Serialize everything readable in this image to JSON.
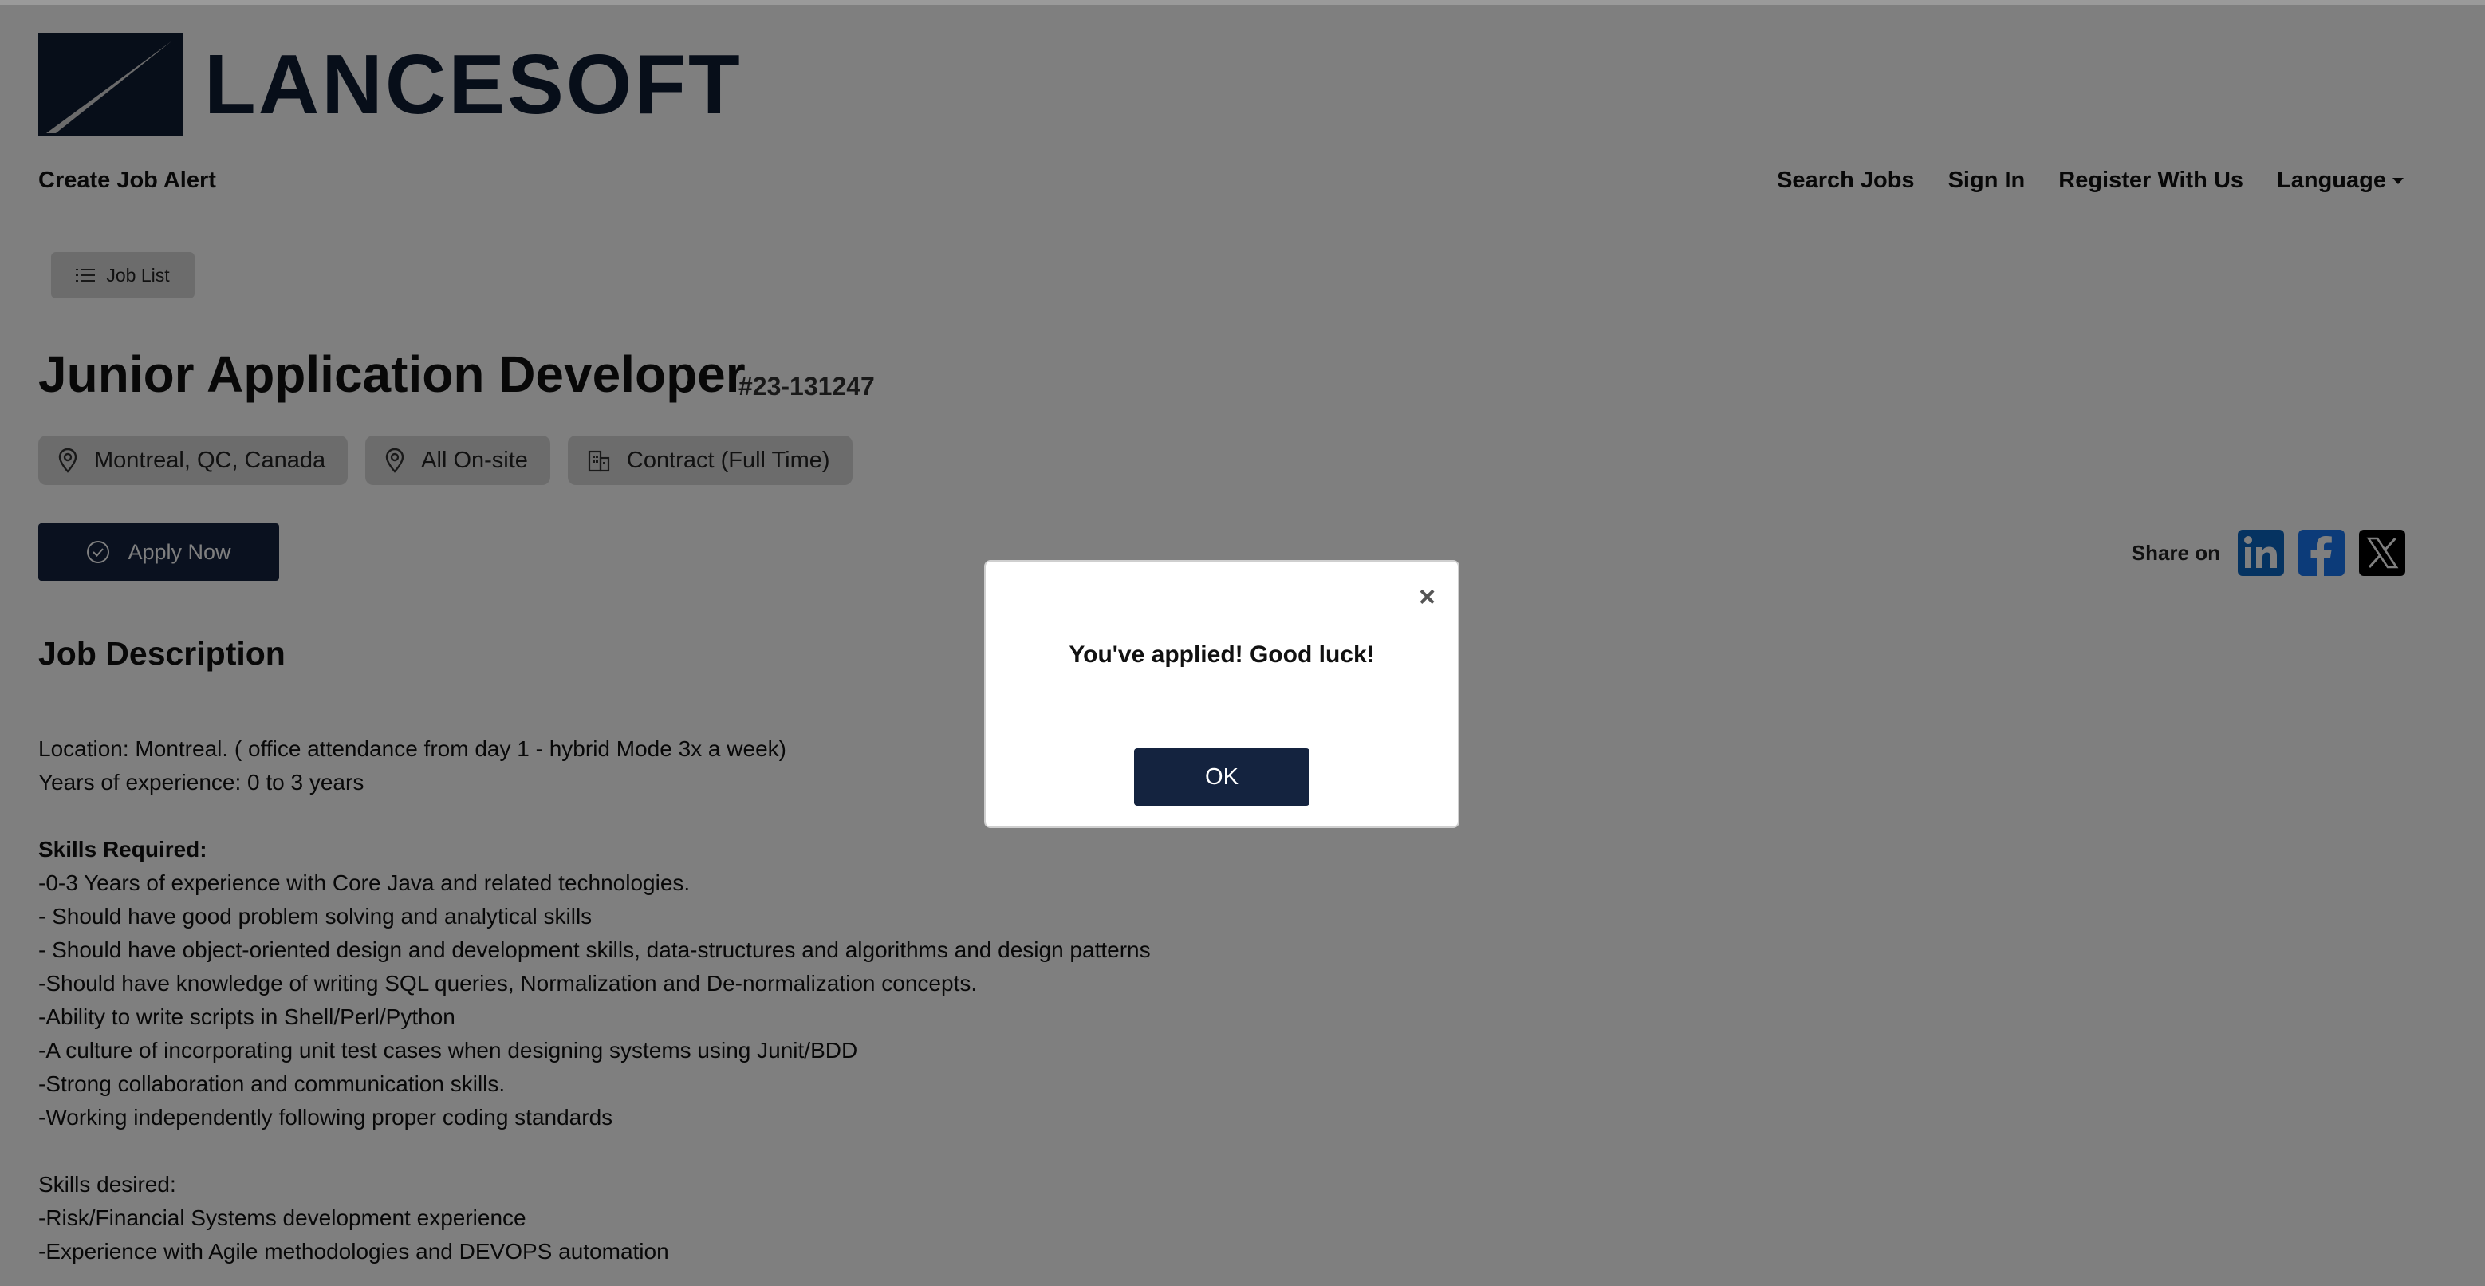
{
  "header": {
    "logo_text": "LANCESOFT",
    "nav_left": "Create Job Alert",
    "nav_right": [
      "Search Jobs",
      "Sign In",
      "Register With Us",
      "Language"
    ]
  },
  "toolbar": {
    "job_list_label": "Job List"
  },
  "job": {
    "title": "Junior Application Developer",
    "code": "#23-131247",
    "chips": [
      {
        "icon": "map-pin-icon",
        "label": "Montreal, QC, Canada"
      },
      {
        "icon": "map-pin-icon",
        "label": "All On-site"
      },
      {
        "icon": "building-icon",
        "label": "Contract (Full Time)"
      }
    ],
    "apply_label": "Apply Now"
  },
  "share": {
    "label": "Share on",
    "networks": [
      {
        "icon": "linkedin-icon",
        "color": "#0a66c2"
      },
      {
        "icon": "facebook-icon",
        "color": "#1877f2"
      },
      {
        "icon": "x-icon",
        "color": "#000000"
      }
    ]
  },
  "description": {
    "heading": "Job Description",
    "location": "Location: Montreal. ( office attendance from day 1 - hybrid Mode 3x a week)",
    "experience": "Years of experience: 0 to 3 years",
    "skills_required_heading": "Skills Required:",
    "skills_required": [
      "-0-3 Years of experience with Core Java and related technologies.",
      "- Should have good problem solving and analytical skills",
      "- Should have object-oriented design and development skills, data-structures and algorithms and design patterns",
      "-Should have knowledge of writing SQL queries, Normalization and De-normalization concepts.",
      "-Ability to write scripts in Shell/Perl/Python",
      "-A culture of incorporating unit test cases when designing systems using Junit/BDD",
      "-Strong collaboration and communication skills.",
      "-Working independently following proper coding standards"
    ],
    "skills_desired_heading": "Skills desired:",
    "skills_desired": [
      "-Risk/Financial Systems development experience",
      "-Experience with Agile methodologies and DEVOPS automation"
    ]
  },
  "modal": {
    "close_symbol": "×",
    "message": "You've applied! Good luck!",
    "ok_label": "OK"
  },
  "colors": {
    "brand_navy": "#14233f",
    "overlay": "rgba(0,0,0,0.5)"
  }
}
